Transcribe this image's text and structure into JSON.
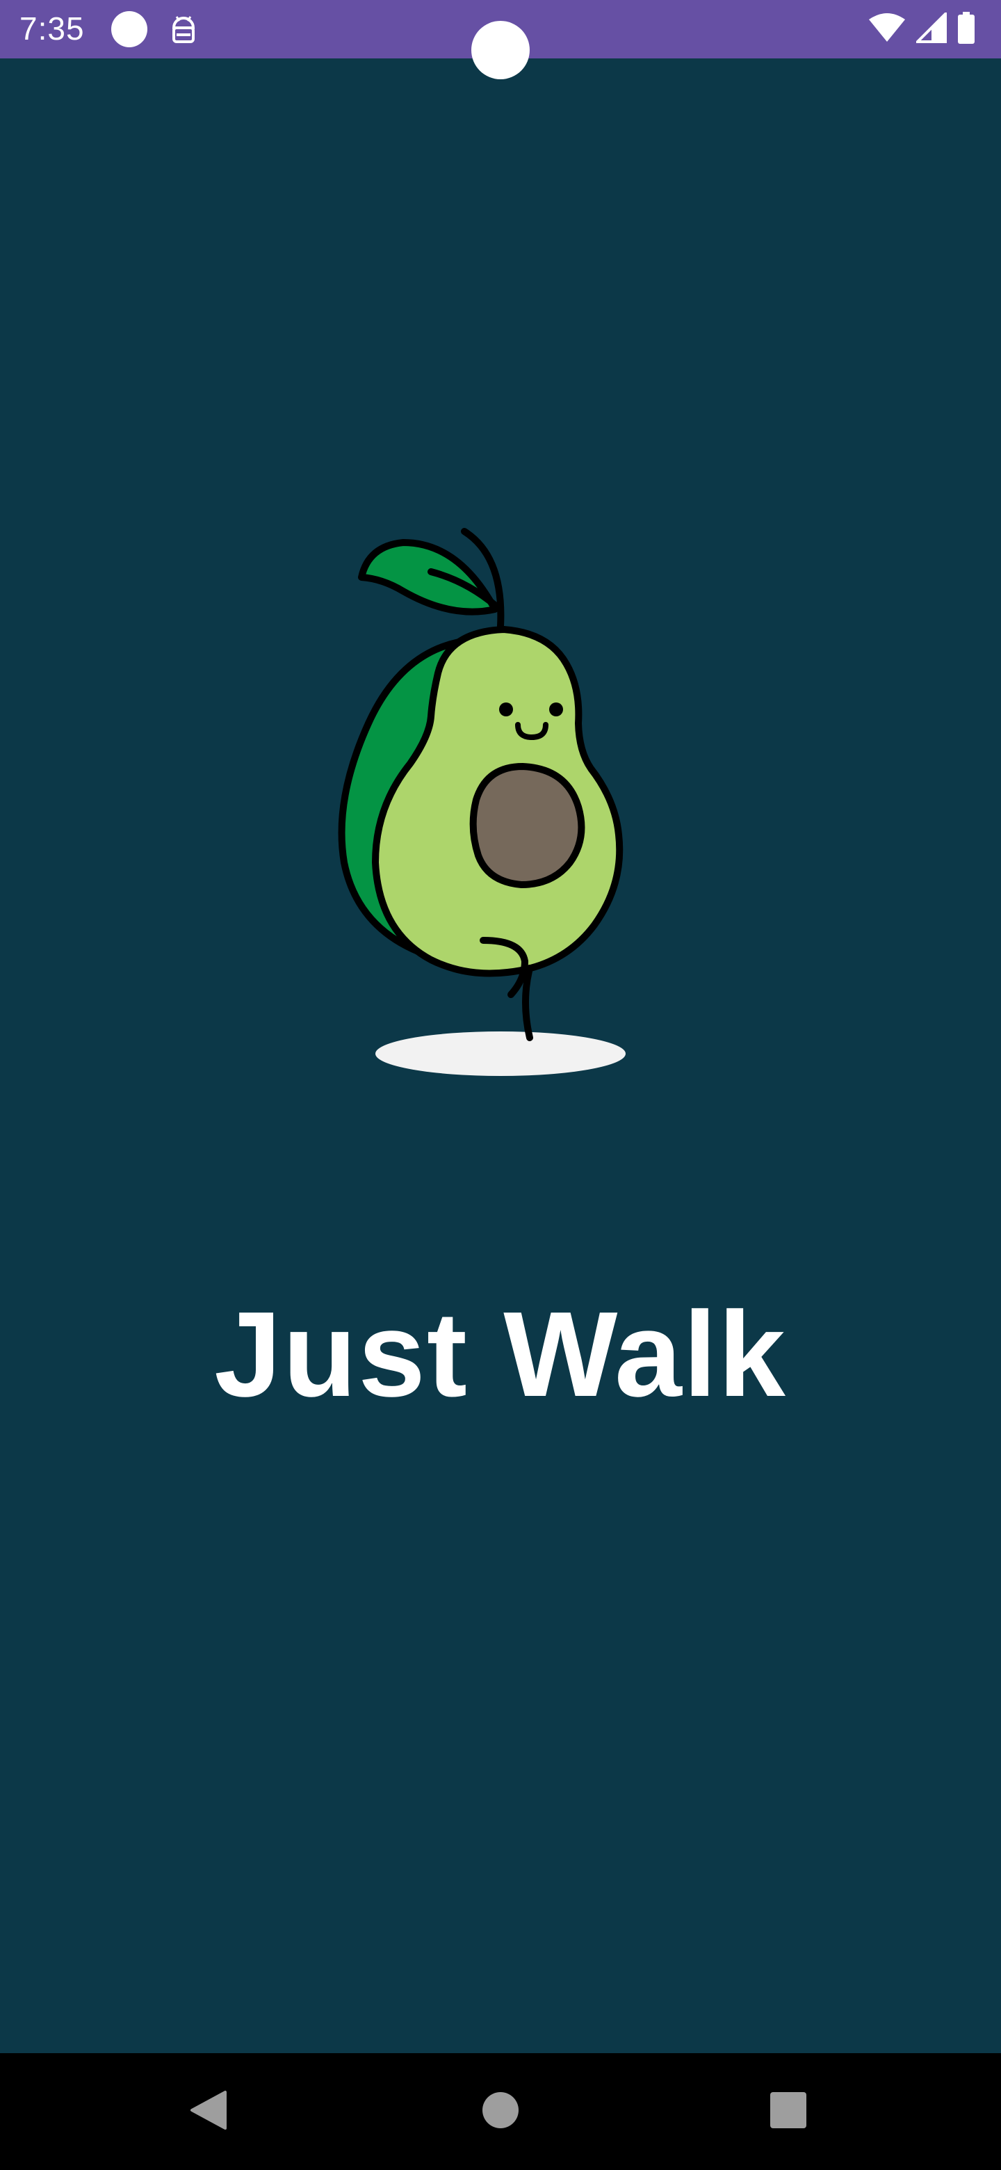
{
  "status_bar": {
    "time": "7:35",
    "background_color": "#6650a4",
    "left_icons": [
      "notification-dot-icon",
      "android-debug-icon"
    ],
    "right_icons": [
      "wifi-icon",
      "cell-signal-icon",
      "battery-icon"
    ]
  },
  "main": {
    "background_color": "#0c3848",
    "illustration": "avocado-mascot-icon",
    "title": "Just Walk"
  },
  "nav_bar": {
    "buttons": [
      "back-icon",
      "home-icon",
      "recents-icon"
    ]
  }
}
